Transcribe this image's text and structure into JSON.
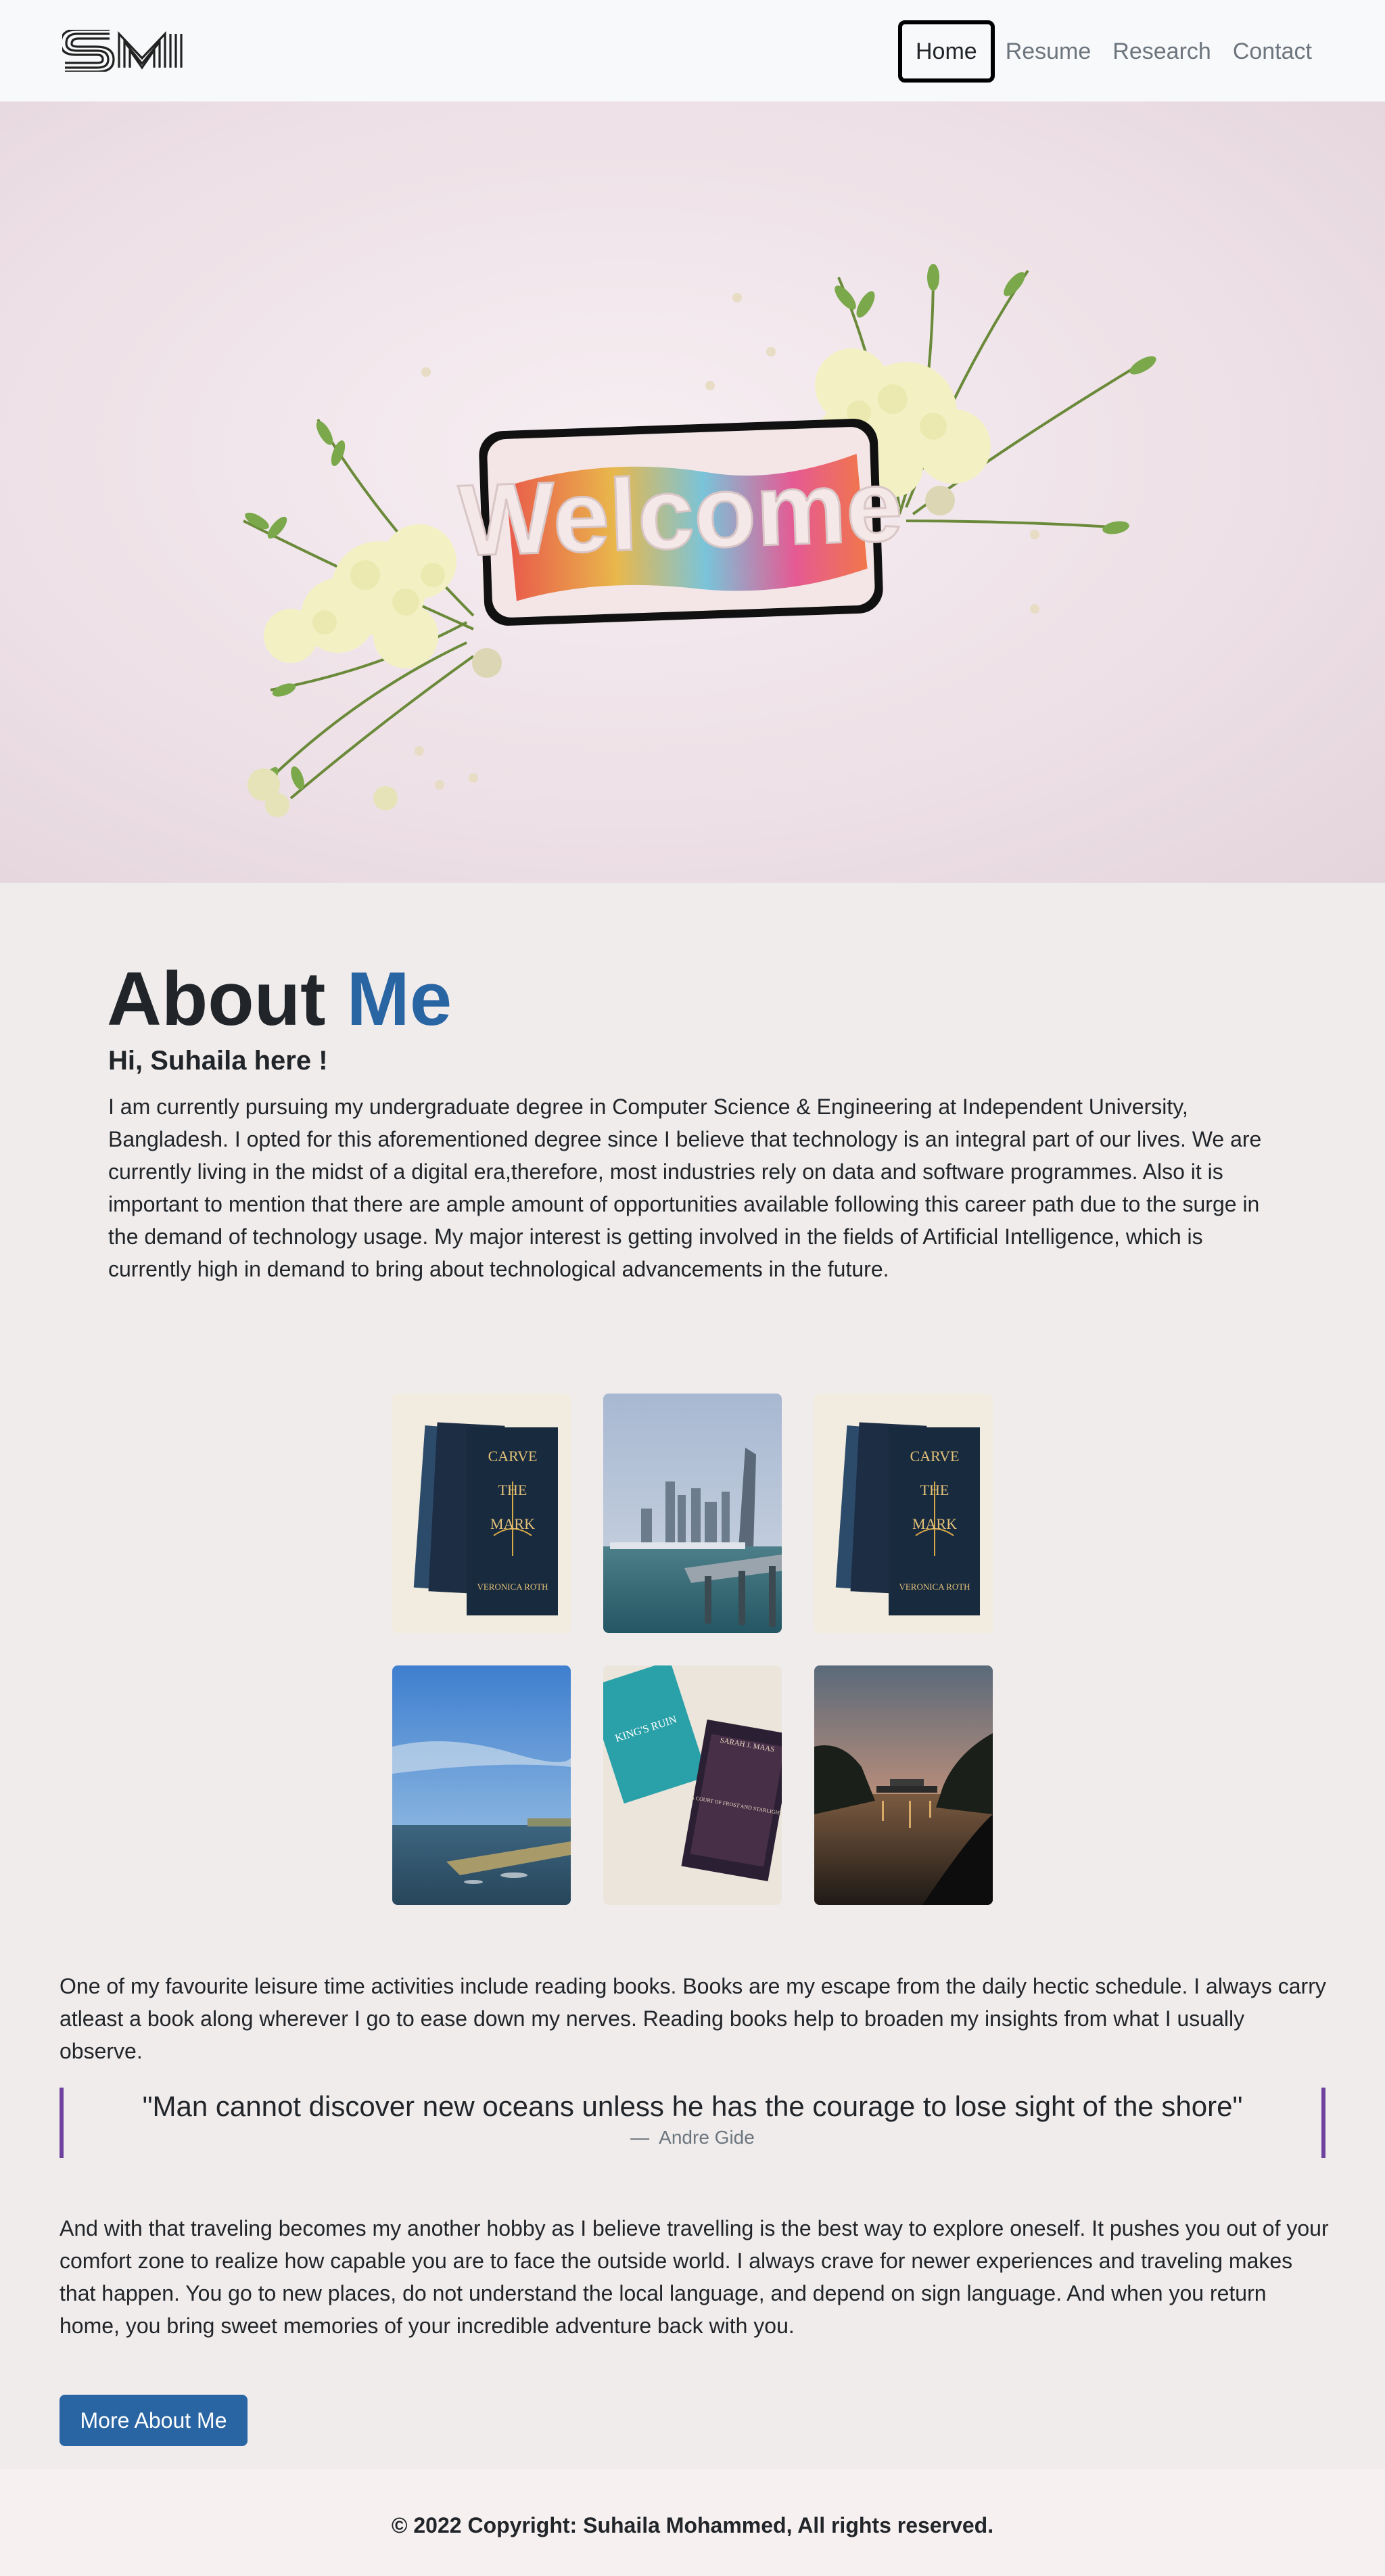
{
  "nav": {
    "logo_text": "SM",
    "links": [
      "Home",
      "Resume",
      "Research",
      "Contact"
    ]
  },
  "hero": {
    "phone_text": "Welcome"
  },
  "about": {
    "title_plain": "About",
    "title_accent": "Me",
    "greeting": "Hi, Suhaila here !",
    "body": "I am currently pursuing my undergraduate degree in Computer Science & Engineering at Independent University, Bangladesh. I opted for this aforementioned degree since I believe that technology is an integral part of our lives. We are currently living in the midst of a digital era,therefore, most industries rely on data and software programmes. Also it is important to mention that there are ample amount of opportunities available following this career path due to the surge in the demand of technology usage. My major interest is getting involved in the fields of Artificial Intelligence, which is currently high in demand to bring about technological advancements in the future."
  },
  "gallery": {
    "book1_title": [
      "CARVE",
      "THE",
      "MARK"
    ],
    "book1_author": "VERONICA ROTH",
    "book2_title": "A COURT OF FROST AND STARLIGHT",
    "book2_author": "SARAH J. MAAS",
    "book3_title": "KING'S RUIN"
  },
  "reading": {
    "text": "One of my favourite leisure time activities include reading books. Books are my escape from the daily hectic schedule. I always carry atleast a book along wherever I go to ease down my nerves. Reading books help to broaden my insights from what I usually observe."
  },
  "quote": {
    "text": "\"Man cannot discover new oceans unless he has the courage to lose sight of the shore\"",
    "dash": "—",
    "author": "Andre Gide"
  },
  "travel": {
    "text": "And with that traveling becomes my another hobby as I believe travelling is the best way to explore oneself. It pushes you out of your comfort zone to realize how capable you are to face the outside world. I always crave for newer experiences and traveling makes that happen. You go to new places, do not understand the local language, and depend on sign language. And when you return home, you bring sweet memories of your incredible adventure back with you."
  },
  "cta": {
    "label": "More About Me"
  },
  "footer": {
    "text": "© 2022 Copyright: Suhaila Mohammed, All rights reserved."
  },
  "colors": {
    "accent": "#2a65a3",
    "quote_border": "#6f42a0",
    "nav_bg": "#f8f9fa",
    "page_bg": "#f0ecec"
  }
}
